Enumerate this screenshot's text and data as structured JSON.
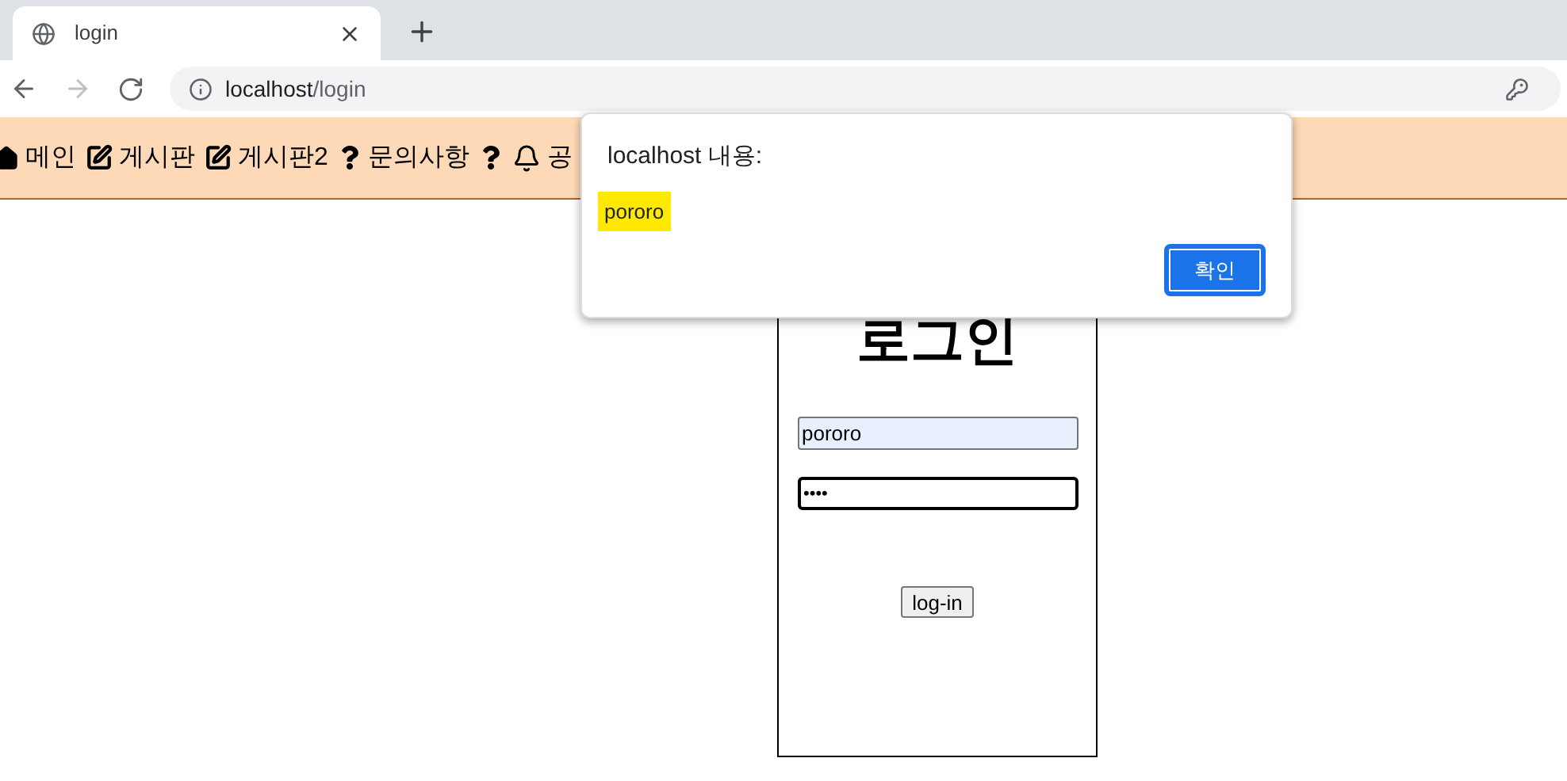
{
  "browser": {
    "tab_title": "login",
    "url_host": "localhost",
    "url_path": "/login"
  },
  "nav": [
    {
      "kind": "home",
      "label": "메인"
    },
    {
      "kind": "edit",
      "label": "게시판"
    },
    {
      "kind": "edit",
      "label": "게시판2"
    },
    {
      "kind": "question",
      "label": "문의사항"
    },
    {
      "kind": "question"
    },
    {
      "kind": "bell",
      "label": "공"
    }
  ],
  "login": {
    "title": "로그인",
    "username": "pororo",
    "password": "••••",
    "button": "log-in"
  },
  "alert": {
    "title": "localhost 내용:",
    "message": "pororo",
    "button": "확인"
  }
}
